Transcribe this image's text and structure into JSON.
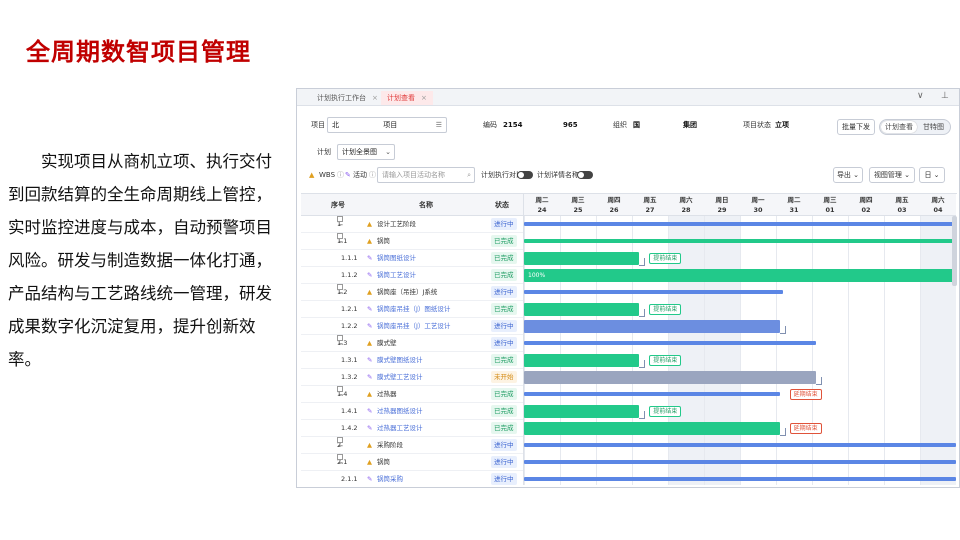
{
  "slide": {
    "title": "全周期数智项目管理",
    "body": "实现项目从商机立项、执行交付到回款结算的全生命周期线上管控，实时监控进度与成本，自动预警项目风险。研发与制造数据一体化打通，产品结构与工艺路线统一管理，研发成果数字化沉淀复用，提升创新效率。"
  },
  "app": {
    "tabs": [
      {
        "label": "计划执行工作台",
        "active": false
      },
      {
        "label": "计划查看",
        "active": true
      }
    ],
    "filters": {
      "project_label": "项目",
      "project_value": "北",
      "project_value2": "项目",
      "code_label": "编码",
      "code_value_a": "2154",
      "code_value_b": "965",
      "org_label": "组织",
      "org_value_a": "国",
      "org_value_b": "集团",
      "status_label": "项目状态",
      "status_value": "立项",
      "batch_button": "批量下发",
      "view_plan": "计划查看",
      "view_gantt": "甘特图"
    },
    "plan": {
      "label": "计划",
      "select_value": "计划全景图"
    },
    "toolbar": {
      "wbs_label": "WBS",
      "activity_label": "活动",
      "search_placeholder": "请输入项目活动名称",
      "compare_label": "计划执行对比",
      "detail_label": "计划详情名称",
      "export_label": "导出",
      "view_manage_label": "视图管理",
      "day_label": "日"
    },
    "columns": {
      "seq": "序号",
      "name": "名称",
      "status": "状态"
    },
    "days": [
      {
        "wd": "周二",
        "d": "24"
      },
      {
        "wd": "周三",
        "d": "25"
      },
      {
        "wd": "周四",
        "d": "26"
      },
      {
        "wd": "周五",
        "d": "27"
      },
      {
        "wd": "周六",
        "d": "28"
      },
      {
        "wd": "周日",
        "d": "29"
      },
      {
        "wd": "周一",
        "d": "30"
      },
      {
        "wd": "周二",
        "d": "31"
      },
      {
        "wd": "周三",
        "d": "01"
      },
      {
        "wd": "周四",
        "d": "02"
      },
      {
        "wd": "周五",
        "d": "03"
      },
      {
        "wd": "周六",
        "d": "04"
      }
    ],
    "rows": [
      {
        "code": "1",
        "name": "设计工艺阶段",
        "status": "进行中",
        "level": 0,
        "kind": "wbs"
      },
      {
        "code": "1.1",
        "name": "锅筒",
        "status": "已完成",
        "level": 1,
        "kind": "wbs"
      },
      {
        "code": "1.1.1",
        "name": "锅筒图纸设计",
        "status": "已完成",
        "level": 2,
        "kind": "act"
      },
      {
        "code": "1.1.2",
        "name": "锅筒工艺设计",
        "status": "已完成",
        "level": 2,
        "kind": "act"
      },
      {
        "code": "1.2",
        "name": "锅筒座（吊挂）J系统",
        "status": "进行中",
        "level": 1,
        "kind": "wbs"
      },
      {
        "code": "1.2.1",
        "name": "锅筒座吊挂（J）图纸设计",
        "status": "已完成",
        "level": 2,
        "kind": "act"
      },
      {
        "code": "1.2.2",
        "name": "锅筒座吊挂（J）工艺设计",
        "status": "进行中",
        "level": 2,
        "kind": "act"
      },
      {
        "code": "1.3",
        "name": "膜式壁",
        "status": "进行中",
        "level": 1,
        "kind": "wbs"
      },
      {
        "code": "1.3.1",
        "name": "膜式壁图纸设计",
        "status": "已完成",
        "level": 2,
        "kind": "act"
      },
      {
        "code": "1.3.2",
        "name": "膜式壁工艺设计",
        "status": "未开始",
        "level": 2,
        "kind": "act"
      },
      {
        "code": "1.4",
        "name": "过热器",
        "status": "已完成",
        "level": 1,
        "kind": "wbs"
      },
      {
        "code": "1.4.1",
        "name": "过热器图纸设计",
        "status": "已完成",
        "level": 2,
        "kind": "act"
      },
      {
        "code": "1.4.2",
        "name": "过热器工艺设计",
        "status": "已完成",
        "level": 2,
        "kind": "act"
      },
      {
        "code": "2",
        "name": "采购阶段",
        "status": "进行中",
        "level": 0,
        "kind": "wbs"
      },
      {
        "code": "2.1",
        "name": "锅筒",
        "status": "进行中",
        "level": 1,
        "kind": "wbs"
      },
      {
        "code": "2.1.1",
        "name": "锅筒采购",
        "status": "进行中",
        "level": 2,
        "kind": "act"
      }
    ],
    "gantt": {
      "bars": [
        {
          "row": 0,
          "start": 0,
          "end": 12,
          "style": "sum"
        },
        {
          "row": 1,
          "start": 0,
          "end": 12,
          "style": "sumg"
        },
        {
          "row": 2,
          "start": 0,
          "end": 3.2,
          "style": "green",
          "tag": "提前结束",
          "tagType": "g"
        },
        {
          "row": 3,
          "start": 0,
          "end": 12,
          "style": "green",
          "text": "100%"
        },
        {
          "row": 4,
          "start": 0,
          "end": 7.2,
          "style": "sum"
        },
        {
          "row": 5,
          "start": 0,
          "end": 3.2,
          "style": "green",
          "tag": "提前结束",
          "tagType": "g"
        },
        {
          "row": 6,
          "start": 0,
          "end": 7.1,
          "style": "blue"
        },
        {
          "row": 7,
          "start": 0,
          "end": 8.1,
          "style": "sum"
        },
        {
          "row": 8,
          "start": 0,
          "end": 3.2,
          "style": "green",
          "tag": "提前结束",
          "tagType": "g"
        },
        {
          "row": 9,
          "start": 0,
          "end": 8.1,
          "style": "gray"
        },
        {
          "row": 10,
          "start": 0,
          "end": 7.1,
          "style": "sum",
          "tag": "延期结束",
          "tagType": "r"
        },
        {
          "row": 11,
          "start": 0,
          "end": 3.2,
          "style": "green",
          "tag": "提前结束",
          "tagType": "g"
        },
        {
          "row": 12,
          "start": 0,
          "end": 7.1,
          "style": "green",
          "tag": "延期结束",
          "tagType": "r"
        },
        {
          "row": 13,
          "start": 0,
          "end": 12,
          "style": "sum"
        },
        {
          "row": 14,
          "start": 0,
          "end": 12,
          "style": "sum"
        },
        {
          "row": 15,
          "start": 0,
          "end": 12,
          "style": "sum"
        }
      ],
      "weekends": [
        4,
        5,
        11
      ]
    }
  }
}
